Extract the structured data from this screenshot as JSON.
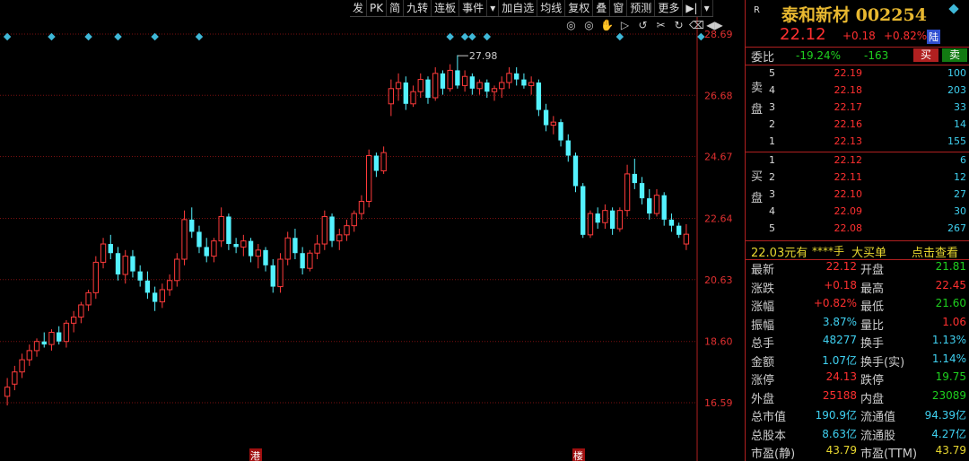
{
  "toolbar": {
    "items": [
      "发",
      "PK",
      "简",
      "九转",
      "连板",
      "事件",
      "▾",
      "加自选",
      "均线",
      "复权",
      "叠",
      "窗",
      "预测",
      "更多",
      "▶|",
      "▾"
    ]
  },
  "tool_icons": [
    "◎",
    "◎",
    "✋",
    "▷",
    "↺",
    "✂",
    "↻",
    "⌫",
    "◀▶"
  ],
  "chart_data": {
    "type": "candlestick",
    "y_ticks": [
      "28.69",
      "26.68",
      "24.67",
      "22.64",
      "20.63",
      "18.60",
      "16.59"
    ],
    "y_tick_values": [
      28.69,
      26.68,
      24.67,
      22.64,
      20.63,
      18.6,
      16.59
    ],
    "max_label": "27.98",
    "max_value": 27.98,
    "bottom_markers": [
      "港",
      "楼"
    ],
    "colors": {
      "up": "#ff3b3b",
      "down": "#54f2ff",
      "marker": "#3fb8d8",
      "grid": "#7a1010"
    },
    "candles": [
      {
        "o": 16.8,
        "h": 17.4,
        "l": 16.5,
        "c": 17.1
      },
      {
        "o": 17.2,
        "h": 17.8,
        "l": 17.0,
        "c": 17.6
      },
      {
        "o": 17.6,
        "h": 18.2,
        "l": 17.4,
        "c": 18.0
      },
      {
        "o": 18.0,
        "h": 18.5,
        "l": 17.8,
        "c": 18.3
      },
      {
        "o": 18.3,
        "h": 18.7,
        "l": 18.1,
        "c": 18.6
      },
      {
        "o": 18.6,
        "h": 18.9,
        "l": 18.4,
        "c": 18.5
      },
      {
        "o": 18.5,
        "h": 19.0,
        "l": 18.3,
        "c": 18.9
      },
      {
        "o": 18.9,
        "h": 19.1,
        "l": 18.5,
        "c": 18.6
      },
      {
        "o": 18.6,
        "h": 19.3,
        "l": 18.4,
        "c": 19.2
      },
      {
        "o": 19.2,
        "h": 19.6,
        "l": 18.9,
        "c": 19.4
      },
      {
        "o": 19.4,
        "h": 19.9,
        "l": 19.2,
        "c": 19.8
      },
      {
        "o": 19.8,
        "h": 20.3,
        "l": 19.6,
        "c": 20.2
      },
      {
        "o": 20.2,
        "h": 21.4,
        "l": 20.0,
        "c": 21.2
      },
      {
        "o": 21.2,
        "h": 22.0,
        "l": 21.0,
        "c": 21.8
      },
      {
        "o": 21.8,
        "h": 22.1,
        "l": 21.3,
        "c": 21.5
      },
      {
        "o": 21.5,
        "h": 21.7,
        "l": 20.6,
        "c": 20.8
      },
      {
        "o": 20.8,
        "h": 21.6,
        "l": 20.5,
        "c": 21.4
      },
      {
        "o": 21.4,
        "h": 21.6,
        "l": 20.7,
        "c": 20.9
      },
      {
        "o": 20.9,
        "h": 21.1,
        "l": 20.4,
        "c": 20.6
      },
      {
        "o": 20.6,
        "h": 20.9,
        "l": 20.0,
        "c": 20.2
      },
      {
        "o": 20.2,
        "h": 20.4,
        "l": 19.6,
        "c": 19.9
      },
      {
        "o": 19.9,
        "h": 20.5,
        "l": 19.7,
        "c": 20.3
      },
      {
        "o": 20.3,
        "h": 20.8,
        "l": 20.1,
        "c": 20.6
      },
      {
        "o": 20.6,
        "h": 21.5,
        "l": 20.4,
        "c": 21.3
      },
      {
        "o": 21.3,
        "h": 22.9,
        "l": 21.1,
        "c": 22.6
      },
      {
        "o": 22.6,
        "h": 23.0,
        "l": 22.0,
        "c": 22.2
      },
      {
        "o": 22.2,
        "h": 22.4,
        "l": 21.5,
        "c": 21.7
      },
      {
        "o": 21.7,
        "h": 22.0,
        "l": 21.2,
        "c": 21.4
      },
      {
        "o": 21.4,
        "h": 22.0,
        "l": 21.2,
        "c": 21.9
      },
      {
        "o": 21.9,
        "h": 23.0,
        "l": 21.7,
        "c": 22.7
      },
      {
        "o": 22.7,
        "h": 22.8,
        "l": 21.6,
        "c": 21.8
      },
      {
        "o": 21.8,
        "h": 22.0,
        "l": 21.5,
        "c": 21.7
      },
      {
        "o": 21.7,
        "h": 22.1,
        "l": 21.4,
        "c": 21.9
      },
      {
        "o": 21.9,
        "h": 22.0,
        "l": 21.2,
        "c": 21.4
      },
      {
        "o": 21.4,
        "h": 21.8,
        "l": 21.0,
        "c": 21.6
      },
      {
        "o": 21.6,
        "h": 21.7,
        "l": 20.9,
        "c": 21.1
      },
      {
        "o": 21.1,
        "h": 21.3,
        "l": 20.2,
        "c": 20.4
      },
      {
        "o": 20.4,
        "h": 21.5,
        "l": 20.2,
        "c": 21.3
      },
      {
        "o": 21.3,
        "h": 22.2,
        "l": 21.1,
        "c": 22.0
      },
      {
        "o": 22.0,
        "h": 22.3,
        "l": 21.3,
        "c": 21.5
      },
      {
        "o": 21.5,
        "h": 21.7,
        "l": 20.8,
        "c": 21.0
      },
      {
        "o": 21.0,
        "h": 21.6,
        "l": 20.9,
        "c": 21.5
      },
      {
        "o": 21.5,
        "h": 22.1,
        "l": 21.3,
        "c": 21.8
      },
      {
        "o": 21.8,
        "h": 22.9,
        "l": 21.6,
        "c": 22.7
      },
      {
        "o": 22.7,
        "h": 22.8,
        "l": 21.7,
        "c": 21.9
      },
      {
        "o": 21.9,
        "h": 22.3,
        "l": 21.6,
        "c": 22.1
      },
      {
        "o": 22.1,
        "h": 22.6,
        "l": 21.9,
        "c": 22.4
      },
      {
        "o": 22.4,
        "h": 22.9,
        "l": 22.2,
        "c": 22.8
      },
      {
        "o": 22.8,
        "h": 23.4,
        "l": 22.6,
        "c": 23.2
      },
      {
        "o": 23.2,
        "h": 24.9,
        "l": 23.0,
        "c": 24.7
      },
      {
        "o": 24.7,
        "h": 24.8,
        "l": 24.0,
        "c": 24.2
      },
      {
        "o": 24.2,
        "h": 25.0,
        "l": 24.1,
        "c": 24.8
      },
      {
        "o": 26.4,
        "h": 27.2,
        "l": 26.0,
        "c": 26.9
      },
      {
        "o": 26.9,
        "h": 27.4,
        "l": 26.5,
        "c": 27.1
      },
      {
        "o": 27.1,
        "h": 27.3,
        "l": 26.2,
        "c": 26.4
      },
      {
        "o": 26.4,
        "h": 27.0,
        "l": 26.3,
        "c": 26.8
      },
      {
        "o": 26.8,
        "h": 27.4,
        "l": 26.6,
        "c": 27.2
      },
      {
        "o": 27.2,
        "h": 27.3,
        "l": 26.4,
        "c": 26.6
      },
      {
        "o": 26.6,
        "h": 27.6,
        "l": 26.5,
        "c": 27.4
      },
      {
        "o": 27.4,
        "h": 27.5,
        "l": 26.7,
        "c": 26.9
      },
      {
        "o": 26.9,
        "h": 27.7,
        "l": 26.8,
        "c": 27.5
      },
      {
        "o": 27.5,
        "h": 28.0,
        "l": 26.9,
        "c": 27.0
      },
      {
        "o": 27.0,
        "h": 27.5,
        "l": 26.8,
        "c": 27.3
      },
      {
        "o": 27.3,
        "h": 27.4,
        "l": 26.7,
        "c": 26.9
      },
      {
        "o": 26.9,
        "h": 27.2,
        "l": 26.7,
        "c": 27.1
      },
      {
        "o": 27.1,
        "h": 27.2,
        "l": 26.6,
        "c": 26.8
      },
      {
        "o": 26.8,
        "h": 27.0,
        "l": 26.5,
        "c": 26.9
      },
      {
        "o": 26.9,
        "h": 27.3,
        "l": 26.6,
        "c": 27.1
      },
      {
        "o": 27.1,
        "h": 27.6,
        "l": 26.9,
        "c": 27.4
      },
      {
        "o": 27.4,
        "h": 27.6,
        "l": 27.0,
        "c": 27.2
      },
      {
        "o": 27.2,
        "h": 27.4,
        "l": 26.9,
        "c": 27.0
      },
      {
        "o": 27.0,
        "h": 27.3,
        "l": 26.7,
        "c": 27.1
      },
      {
        "o": 27.1,
        "h": 27.2,
        "l": 26.0,
        "c": 26.2
      },
      {
        "o": 26.2,
        "h": 26.4,
        "l": 25.5,
        "c": 25.7
      },
      {
        "o": 25.7,
        "h": 26.0,
        "l": 25.4,
        "c": 25.8
      },
      {
        "o": 25.8,
        "h": 25.9,
        "l": 25.0,
        "c": 25.2
      },
      {
        "o": 25.2,
        "h": 25.4,
        "l": 24.5,
        "c": 24.7
      },
      {
        "o": 24.7,
        "h": 24.8,
        "l": 23.5,
        "c": 23.7
      },
      {
        "o": 23.7,
        "h": 23.8,
        "l": 22.0,
        "c": 22.1
      },
      {
        "o": 22.1,
        "h": 22.9,
        "l": 22.0,
        "c": 22.8
      },
      {
        "o": 22.8,
        "h": 23.0,
        "l": 22.3,
        "c": 22.5
      },
      {
        "o": 22.5,
        "h": 23.1,
        "l": 22.3,
        "c": 22.9
      },
      {
        "o": 22.9,
        "h": 23.0,
        "l": 22.1,
        "c": 22.3
      },
      {
        "o": 22.3,
        "h": 23.0,
        "l": 22.2,
        "c": 22.9
      },
      {
        "o": 22.9,
        "h": 24.4,
        "l": 22.7,
        "c": 24.1
      },
      {
        "o": 24.1,
        "h": 24.6,
        "l": 23.6,
        "c": 23.8
      },
      {
        "o": 23.8,
        "h": 24.0,
        "l": 23.1,
        "c": 23.3
      },
      {
        "o": 23.3,
        "h": 23.6,
        "l": 22.6,
        "c": 22.8
      },
      {
        "o": 22.8,
        "h": 23.6,
        "l": 22.7,
        "c": 23.4
      },
      {
        "o": 23.4,
        "h": 23.5,
        "l": 22.4,
        "c": 22.6
      },
      {
        "o": 22.6,
        "h": 22.8,
        "l": 22.2,
        "c": 22.4
      },
      {
        "o": 22.4,
        "h": 22.5,
        "l": 22.0,
        "c": 22.1
      },
      {
        "o": 21.8,
        "h": 22.45,
        "l": 21.6,
        "c": 22.12
      }
    ],
    "marker_indices": [
      0,
      6,
      11,
      15,
      20,
      26,
      60,
      62,
      63,
      65,
      83,
      94
    ]
  },
  "stock": {
    "r_mark": "R",
    "title": "泰和新材 002254",
    "price": "22.12",
    "change": "+0.18",
    "pct": "+0.82%",
    "badge": "陆"
  },
  "weibi": {
    "label": "委比",
    "ratio": "-19.24%",
    "diff": "-163",
    "buy": "买",
    "sell": "卖"
  },
  "sell_side": {
    "label": "卖盘",
    "levels": [
      {
        "lv": "5",
        "price": "22.19",
        "vol": "100"
      },
      {
        "lv": "4",
        "price": "22.18",
        "vol": "203"
      },
      {
        "lv": "3",
        "price": "22.17",
        "vol": "33"
      },
      {
        "lv": "2",
        "price": "22.16",
        "vol": "14"
      },
      {
        "lv": "1",
        "price": "22.13",
        "vol": "155"
      }
    ]
  },
  "buy_side": {
    "label": "买盘",
    "levels": [
      {
        "lv": "1",
        "price": "22.12",
        "vol": "6"
      },
      {
        "lv": "2",
        "price": "22.11",
        "vol": "12"
      },
      {
        "lv": "3",
        "price": "22.10",
        "vol": "27"
      },
      {
        "lv": "4",
        "price": "22.09",
        "vol": "30"
      },
      {
        "lv": "5",
        "price": "22.08",
        "vol": "267"
      }
    ]
  },
  "big_order": {
    "price": "22.03元有",
    "hand": "****手",
    "label": "大买单",
    "link": "点击查看"
  },
  "stats": [
    {
      "l1": "最新",
      "v1": "22.12",
      "c1": "red",
      "l2": "开盘",
      "v2": "21.81",
      "c2": "green"
    },
    {
      "l1": "涨跌",
      "v1": "+0.18",
      "c1": "red",
      "l2": "最高",
      "v2": "22.45",
      "c2": "red"
    },
    {
      "l1": "涨幅",
      "v1": "+0.82%",
      "c1": "red",
      "l2": "最低",
      "v2": "21.60",
      "c2": "green"
    },
    {
      "l1": "振幅",
      "v1": "3.87%",
      "c1": "cyan",
      "l2": "量比",
      "v2": "1.06",
      "c2": "red"
    },
    {
      "l1": "总手",
      "v1": "48277",
      "c1": "cyan",
      "l2": "换手",
      "v2": "1.13%",
      "c2": "cyan"
    },
    {
      "l1": "金额",
      "v1": "1.07亿",
      "c1": "cyan",
      "l2": "换手(实)",
      "v2": "1.14%",
      "c2": "cyan"
    },
    {
      "l1": "涨停",
      "v1": "24.13",
      "c1": "red",
      "l2": "跌停",
      "v2": "19.75",
      "c2": "green"
    },
    {
      "l1": "外盘",
      "v1": "25188",
      "c1": "red",
      "l2": "内盘",
      "v2": "23089",
      "c2": "green"
    },
    {
      "l1": "总市值",
      "v1": "190.9亿",
      "c1": "cyan",
      "l2": "流通值",
      "v2": "94.39亿",
      "c2": "cyan"
    },
    {
      "l1": "总股本",
      "v1": "8.63亿",
      "c1": "cyan",
      "l2": "流通股",
      "v2": "4.27亿",
      "c2": "cyan"
    },
    {
      "l1": "市盈(静)",
      "v1": "43.79",
      "c1": "yellow",
      "l2": "市盈(TTM)",
      "v2": "43.79",
      "c2": "yellow"
    }
  ]
}
